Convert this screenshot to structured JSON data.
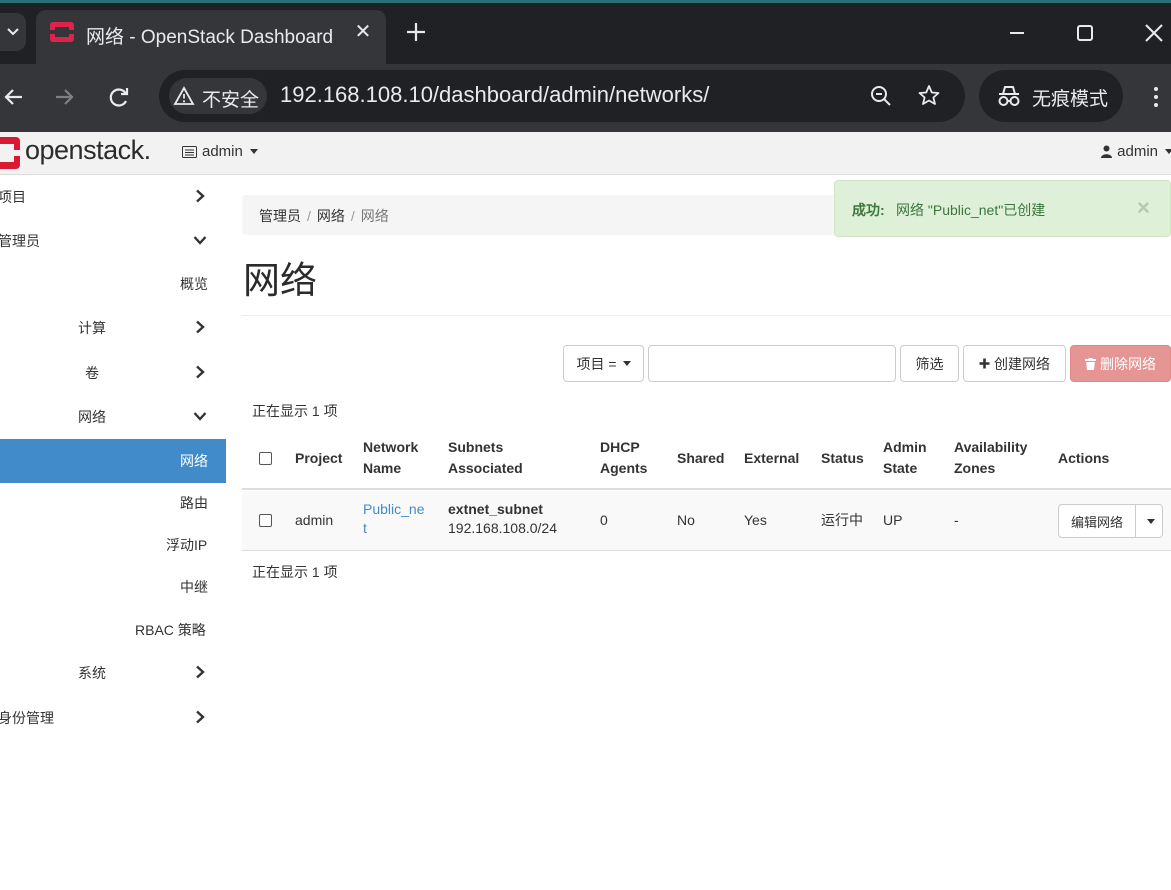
{
  "browser": {
    "tab_title": "网络 - OpenStack Dashboard",
    "insecure_label": "不安全",
    "url": "192.168.108.10/dashboard/admin/networks/",
    "incognito_label": "无痕模式"
  },
  "header": {
    "logo_text": "openstack.",
    "project_label": "admin",
    "user_label": "admin"
  },
  "sidebar": {
    "items": [
      {
        "label": "项目"
      },
      {
        "label": "管理员"
      },
      {
        "label": "概览"
      },
      {
        "label": "计算"
      },
      {
        "label": "卷"
      },
      {
        "label": "网络"
      },
      {
        "label": "网络"
      },
      {
        "label": "路由"
      },
      {
        "label": "浮动IP"
      },
      {
        "label": "中继"
      },
      {
        "label": "RBAC 策略"
      },
      {
        "label": "系统"
      },
      {
        "label": "身份管理"
      }
    ]
  },
  "breadcrumb": [
    "管理员",
    "网络",
    "网络"
  ],
  "page_title": "网络",
  "alert": {
    "title": "成功:",
    "message": "网络 \"Public_net\"已创建",
    "close": "×"
  },
  "filter": {
    "field_label": "项目 =",
    "button": "筛选"
  },
  "actions": {
    "create": "创建网络",
    "delete": "删除网络"
  },
  "count_text": "正在显示 1 项",
  "table": {
    "headers": {
      "project": "Project",
      "network_name_1": "Network",
      "network_name_2": "Name",
      "subnets_1": "Subnets",
      "subnets_2": "Associated",
      "dhcp_1": "DHCP",
      "dhcp_2": "Agents",
      "shared": "Shared",
      "external": "External",
      "status": "Status",
      "admin_1": "Admin",
      "admin_2": "State",
      "az_1": "Availability",
      "az_2": "Zones",
      "actions": "Actions"
    },
    "rows": [
      {
        "project": "admin",
        "name_1": "Public_ne",
        "name_2": "t",
        "subnet_name": "extnet_subnet",
        "subnet_cidr": "192.168.108.0/24",
        "dhcp_agents": "0",
        "shared": "No",
        "external": "Yes",
        "status": "运行中",
        "admin_state": "UP",
        "az": "-",
        "action": "编辑网络"
      }
    ]
  }
}
